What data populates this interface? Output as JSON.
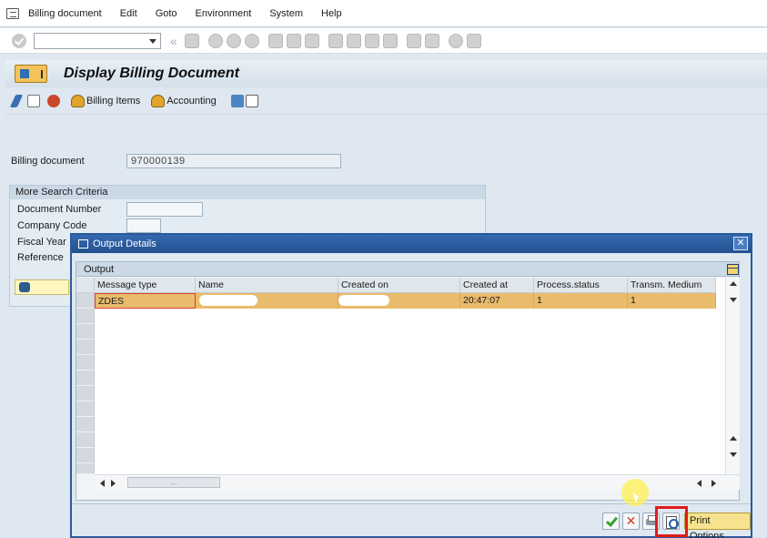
{
  "menu": {
    "items": [
      "Billing document",
      "Edit",
      "Goto",
      "Environment",
      "System",
      "Help"
    ]
  },
  "toolbar": {
    "command_field_value": ""
  },
  "title": {
    "text": "Display Billing Document"
  },
  "app_toolbar": {
    "billing_items_label": "Billing Items",
    "accounting_label": "Accounting"
  },
  "form": {
    "billing_document_label": "Billing document",
    "billing_document_value": "970000139",
    "more_search_criteria": "More Search Criteria",
    "document_number_label": "Document Number",
    "company_code_label": "Company Code",
    "fiscal_year_label": "Fiscal Year",
    "reference_label": "Reference"
  },
  "dialog": {
    "title": "Output Details",
    "group_title": "Output",
    "columns": [
      "Message type",
      "Name",
      "Created on",
      "Created at",
      "Process.status",
      "Transm. Medium"
    ],
    "rows": [
      {
        "message_type": "ZDES",
        "name": "",
        "created_on": "",
        "created_at": "20:47:07",
        "process_status": "1",
        "transm_medium": "1"
      }
    ],
    "hscroll_thumb": "...",
    "print_options_label": "Print Options"
  }
}
